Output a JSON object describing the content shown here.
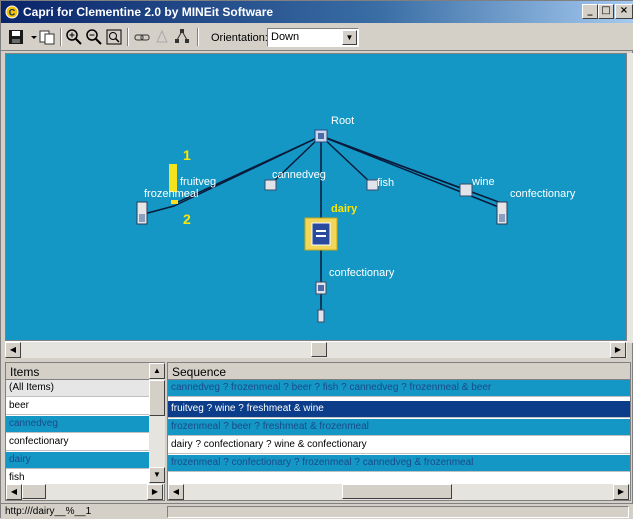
{
  "window": {
    "title": "Capri for Clementine 2.0 by MINEit Software",
    "controls": [
      "_",
      "□",
      "×"
    ]
  },
  "toolbar": {
    "buttons": [
      "save-icon",
      "dropdown-icon",
      "copy-icon",
      "zoom-fit-icon",
      "zoom-out-icon",
      "zoom-box-icon",
      "link-icon",
      "lasso-icon",
      "tree-icon"
    ],
    "orientation_label": "Orientation:",
    "orientation_value": "Down"
  },
  "tree": {
    "root": "Root",
    "nodes": {
      "fruitveg": "fruitveg",
      "frozenmeal": "frozenmeal",
      "cannedveg": "cannedveg",
      "fish": "fish",
      "wine": "wine",
      "confectionary_top": "confectionary",
      "dairy": "dairy",
      "confectionary_child": "confectionary"
    },
    "markers": [
      "1",
      "2"
    ],
    "colors": {
      "background": "#1497c4",
      "selected_label": "#ffe600",
      "edge": "#0a1a3a"
    }
  },
  "items": {
    "header": "Items",
    "rows": [
      "(All Items)",
      "beer",
      "cannedveg",
      "confectionary",
      "dairy",
      "fish"
    ]
  },
  "sequence": {
    "header": "Sequence",
    "rows": [
      "cannedveg ? frozenmeal ? beer ? fish ? cannedveg ? frozenmeal & beer",
      "fruitveg ? wine ? freshmeat & wine",
      "frozenmeal ? beer ? freshmeat & frozenmeal",
      "dairy ? confectionary ? wine & confectionary",
      "frozenmeal ? confectionary ? frozenmeal ? cannedveg & frozenmeal"
    ]
  },
  "status": {
    "text": "http:///dairy__%__1"
  }
}
